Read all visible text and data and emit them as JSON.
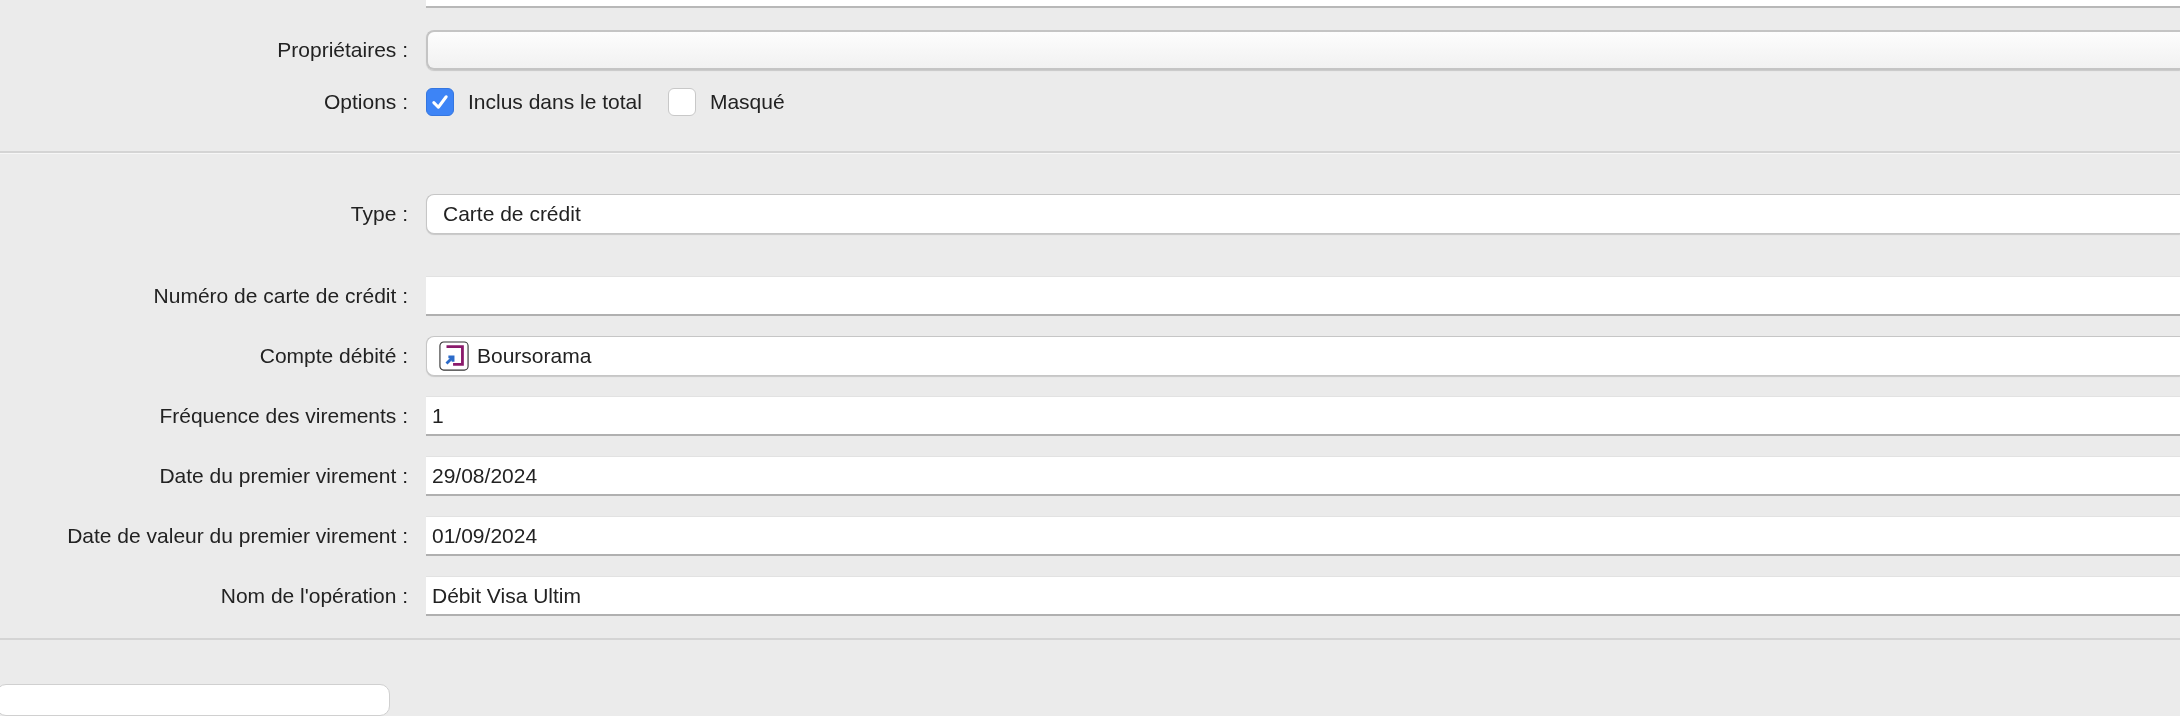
{
  "general": {
    "owners": {
      "label": "Propriétaires :"
    },
    "options": {
      "label": "Options :",
      "checkboxes": [
        {
          "label": "Inclus dans le total",
          "checked": true
        },
        {
          "label": "Masqué",
          "checked": false
        }
      ]
    }
  },
  "details": {
    "type": {
      "label": "Type :",
      "value": "Carte de crédit"
    },
    "fields": [
      {
        "kind": "text",
        "label": "Numéro de carte de crédit :"
      },
      {
        "kind": "account",
        "label": "Compte débité :",
        "value": "Boursorama"
      },
      {
        "kind": "text",
        "label": "Fréquence des virements :",
        "value": "1"
      },
      {
        "kind": "text",
        "label": "Date du premier virement :",
        "value": "29/08/2024"
      },
      {
        "kind": "text",
        "label": "Date de valeur du premier virement :",
        "value": "01/09/2024"
      },
      {
        "kind": "text",
        "label": "Nom de l'opération :",
        "value": "Débit Visa Ultim"
      }
    ]
  }
}
